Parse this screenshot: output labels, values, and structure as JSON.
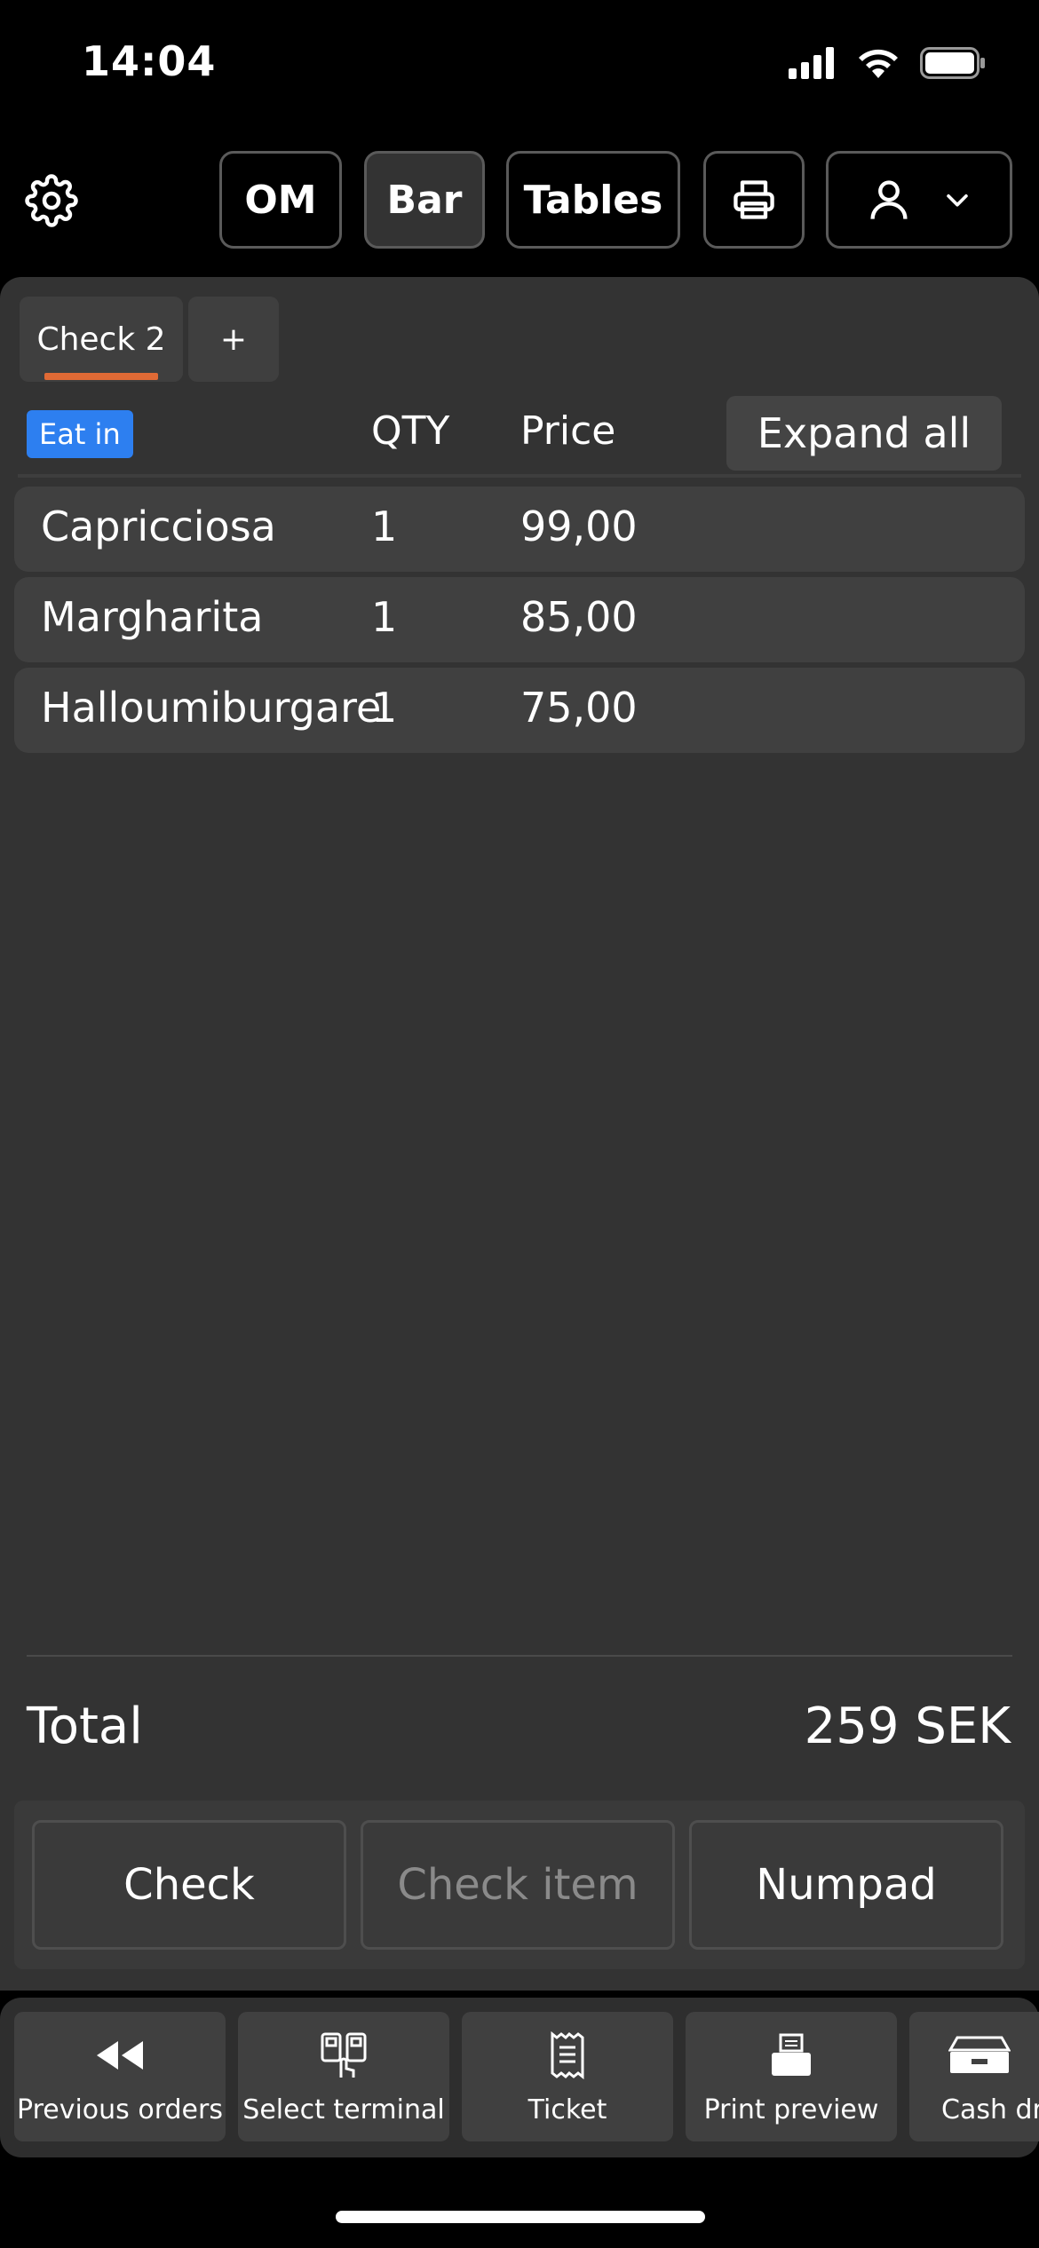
{
  "status": {
    "time": "14:04"
  },
  "topnav": {
    "om_label": "OM",
    "bar_label": "Bar",
    "tables_label": "Tables"
  },
  "tabs": [
    {
      "label": "Check 2",
      "active": true
    },
    {
      "label": "+"
    }
  ],
  "order": {
    "mode_badge": "Eat in",
    "col_qty": "QTY",
    "col_price": "Price",
    "expand_label": "Expand all",
    "items": [
      {
        "name": "Capricciosa",
        "qty": "1",
        "price": "99,00"
      },
      {
        "name": "Margharita",
        "qty": "1",
        "price": "85,00"
      },
      {
        "name": "Halloumiburgare",
        "qty": "1",
        "price": "75,00"
      }
    ]
  },
  "total": {
    "label": "Total",
    "value": "259 SEK"
  },
  "actions": {
    "check": "Check",
    "check_item": "Check item",
    "numpad": "Numpad"
  },
  "toolbar": [
    {
      "label": "Previous orders",
      "icon": "rewind-icon"
    },
    {
      "label": "Select terminal",
      "icon": "terminal-icon"
    },
    {
      "label": "Ticket",
      "icon": "receipt-icon"
    },
    {
      "label": "Print preview",
      "icon": "printer-icon"
    },
    {
      "label": "Cash drawer",
      "icon": "cash-drawer-icon"
    }
  ],
  "colors": {
    "accent": "#e06a35",
    "badge": "#2d7ff0",
    "panel": "#333333"
  }
}
